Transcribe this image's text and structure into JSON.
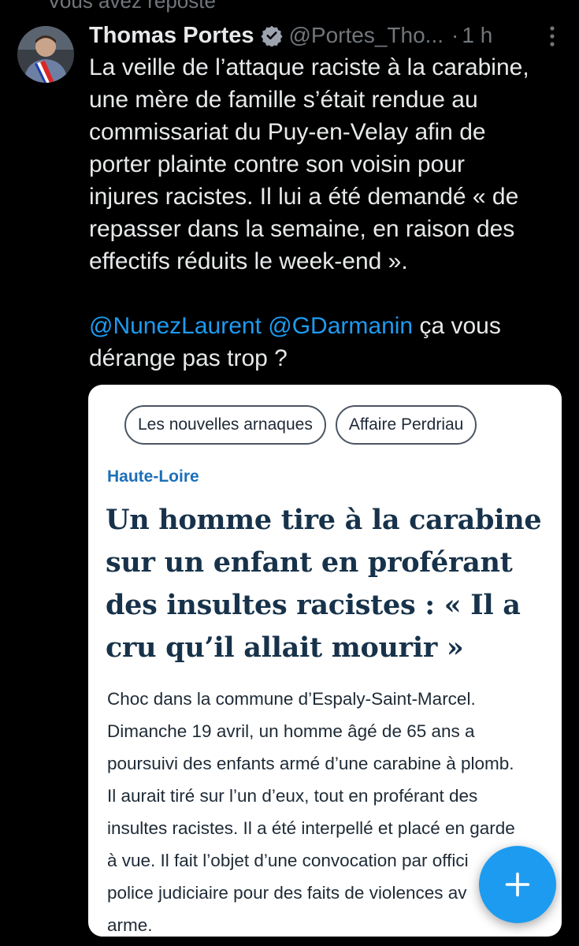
{
  "repost": {
    "label": "Vous avez reposté"
  },
  "tweet": {
    "author": {
      "display_name": "Thomas Portes",
      "handle": "@Portes_Tho...",
      "verified": true
    },
    "separator": "·",
    "time": "1 h",
    "text_lines": [
      "La veille de l’attaque raciste à la carabine,",
      "une mère de famille s’était rendue au",
      "commissariat du Puy-en-Velay afin de",
      "porter plainte contre son voisin pour",
      "injures racistes. Il lui a été demandé « de",
      "repasser dans la semaine, en raison des",
      "effectifs réduits le week-end »."
    ],
    "mention_1": "@NunezLaurent",
    "mention_2": "@GDarmanin",
    "after_mentions": " ça vous",
    "final_line": "dérange pas trop ?"
  },
  "article_card": {
    "chips": [
      "Les nouvelles arnaques",
      "Affaire Perdriau"
    ],
    "region": "Haute-Loire",
    "headline_lines": [
      "Un homme tire à la carabine",
      "sur un enfant en proférant",
      "des insultes racistes : « Il a",
      "cru qu’il allait mourir »"
    ],
    "body_lines": [
      "Choc dans la commune d’Espaly-Saint-Marcel.",
      "Dimanche 19 avril, un homme âgé de 65 ans a",
      "poursuivi des enfants armé d’une carabine à plomb.",
      "Il aurait tiré sur l’un d’eux, tout en proférant des",
      "insultes racistes. Il a été interpellé et placé en garde",
      "à vue. Il fait l’objet d’une convocation par offici",
      "police judiciaire pour des faits de violences av",
      "arme."
    ]
  },
  "icons": {
    "verified": "verified-badge-icon",
    "more": "more-options-icon",
    "compose": "plus-icon"
  },
  "colors": {
    "background": "#000000",
    "text": "#e7e9ea",
    "muted": "#71767b",
    "accent": "#1d9bf0"
  }
}
